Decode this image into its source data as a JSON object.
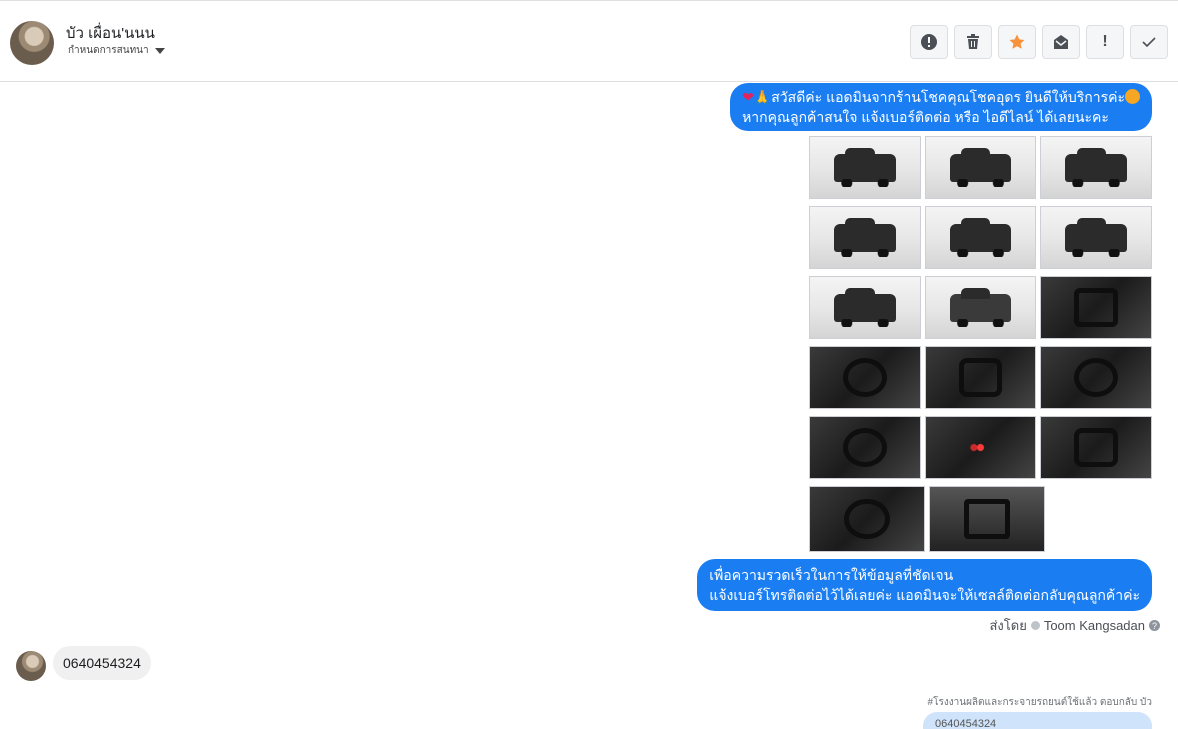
{
  "header": {
    "contact_name": "บัว เผื่อน'นนน",
    "assign_label": "กำหนดการสนทนา",
    "actions": [
      {
        "name": "report-spam-icon",
        "glyph": "!"
      },
      {
        "name": "trash-icon",
        "glyph": ""
      },
      {
        "name": "star-icon",
        "glyph": "★"
      },
      {
        "name": "mark-unread-icon",
        "glyph": ""
      },
      {
        "name": "follow-up-icon",
        "glyph": "!"
      },
      {
        "name": "done-icon",
        "glyph": "✓"
      }
    ],
    "colors": {
      "star": "#f7923b",
      "accent": "#1a7ef2"
    }
  },
  "messages": {
    "greeting_line1_text": "สวัสดีค่ะ แอดมินจากร้านโชคคุณโชคอุดร ยินดีให้บริการค่ะ",
    "greeting_line2": "หากคุณลูกค้าสนใจ แจ้งเบอร์ติดต่อ หรือ ไอดีไลน์ ได้เลยนะคะ",
    "photo_rows": [
      [
        "ext",
        "ext",
        "ext"
      ],
      [
        "ext",
        "ext",
        "ext"
      ],
      [
        "ext",
        "ext",
        "int"
      ],
      [
        "int",
        "int",
        "int"
      ],
      [
        "int",
        "int",
        "int"
      ],
      [
        "int",
        "int"
      ]
    ],
    "info_line1": "เพื่อความรวดเร็วในการให้ข้อมูลที่ชัดเจน",
    "info_line2": "แจ้งเบอร์โทรติดต่อไว้ได้เลยค่ะ แอดมินจะให้เซลล์ติดต่อกลับคุณลูกค้าค่ะ",
    "sent_by_prefix": "ส่งโดย",
    "sent_by_name": "Toom Kangsadan",
    "incoming_text": "0640454324",
    "reply_note": "#โรงงานผลิตและกระจายรถยนต์ใช้แล้ว ตอบกลับ บัว",
    "draft_text": "0640454324"
  }
}
